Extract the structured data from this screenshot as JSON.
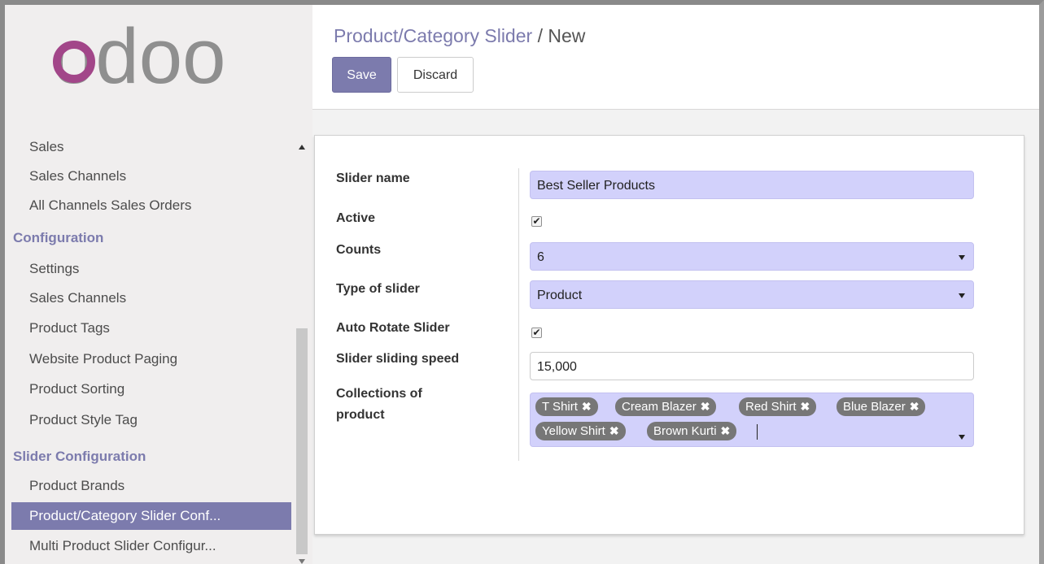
{
  "sidebar": {
    "logo_text": "odoo",
    "items": [
      {
        "label": "Sales",
        "type": "item"
      },
      {
        "label": "Sales Channels",
        "type": "item"
      },
      {
        "label": "All Channels Sales Orders",
        "type": "item"
      },
      {
        "label": "Configuration",
        "type": "section"
      },
      {
        "label": "Settings",
        "type": "item"
      },
      {
        "label": "Sales Channels",
        "type": "item"
      },
      {
        "label": "Product Tags",
        "type": "item"
      },
      {
        "label": "Website Product Paging",
        "type": "item"
      },
      {
        "label": "Product Sorting",
        "type": "item"
      },
      {
        "label": "Product Style Tag",
        "type": "item"
      },
      {
        "label": "Slider Configuration",
        "type": "section"
      },
      {
        "label": "Product Brands",
        "type": "item"
      },
      {
        "label": "Product/Category Slider Conf...",
        "type": "item",
        "active": true
      },
      {
        "label": "Multi Product Slider Configur...",
        "type": "item"
      }
    ]
  },
  "header": {
    "breadcrumb_parent": "Product/Category Slider",
    "breadcrumb_sep": "/",
    "breadcrumb_current": "New",
    "save_label": "Save",
    "discard_label": "Discard"
  },
  "form": {
    "slider_name_label": "Slider name",
    "slider_name_value": "Best Seller Products",
    "active_label": "Active",
    "active_checked": true,
    "counts_label": "Counts",
    "counts_value": "6",
    "type_label": "Type of slider",
    "type_value": "Product",
    "auto_rotate_label": "Auto Rotate Slider",
    "auto_rotate_checked": true,
    "speed_label": "Slider sliding speed",
    "speed_value": "15,000",
    "collections_label_1": "Collections of",
    "collections_label_2": "product",
    "collections": [
      "T Shirt",
      "Cream Blazer",
      "Red Shirt",
      "Blue Blazer",
      "Yellow Shirt",
      "Brown Kurti"
    ],
    "check_glyph": "✔",
    "remove_glyph": "✖"
  },
  "colors": {
    "brand": "#7c7bad",
    "logo_o": "#a24689",
    "logo_gray": "#8f8f8f",
    "field_bg": "#d2d1fb",
    "tag_bg": "#777777"
  }
}
